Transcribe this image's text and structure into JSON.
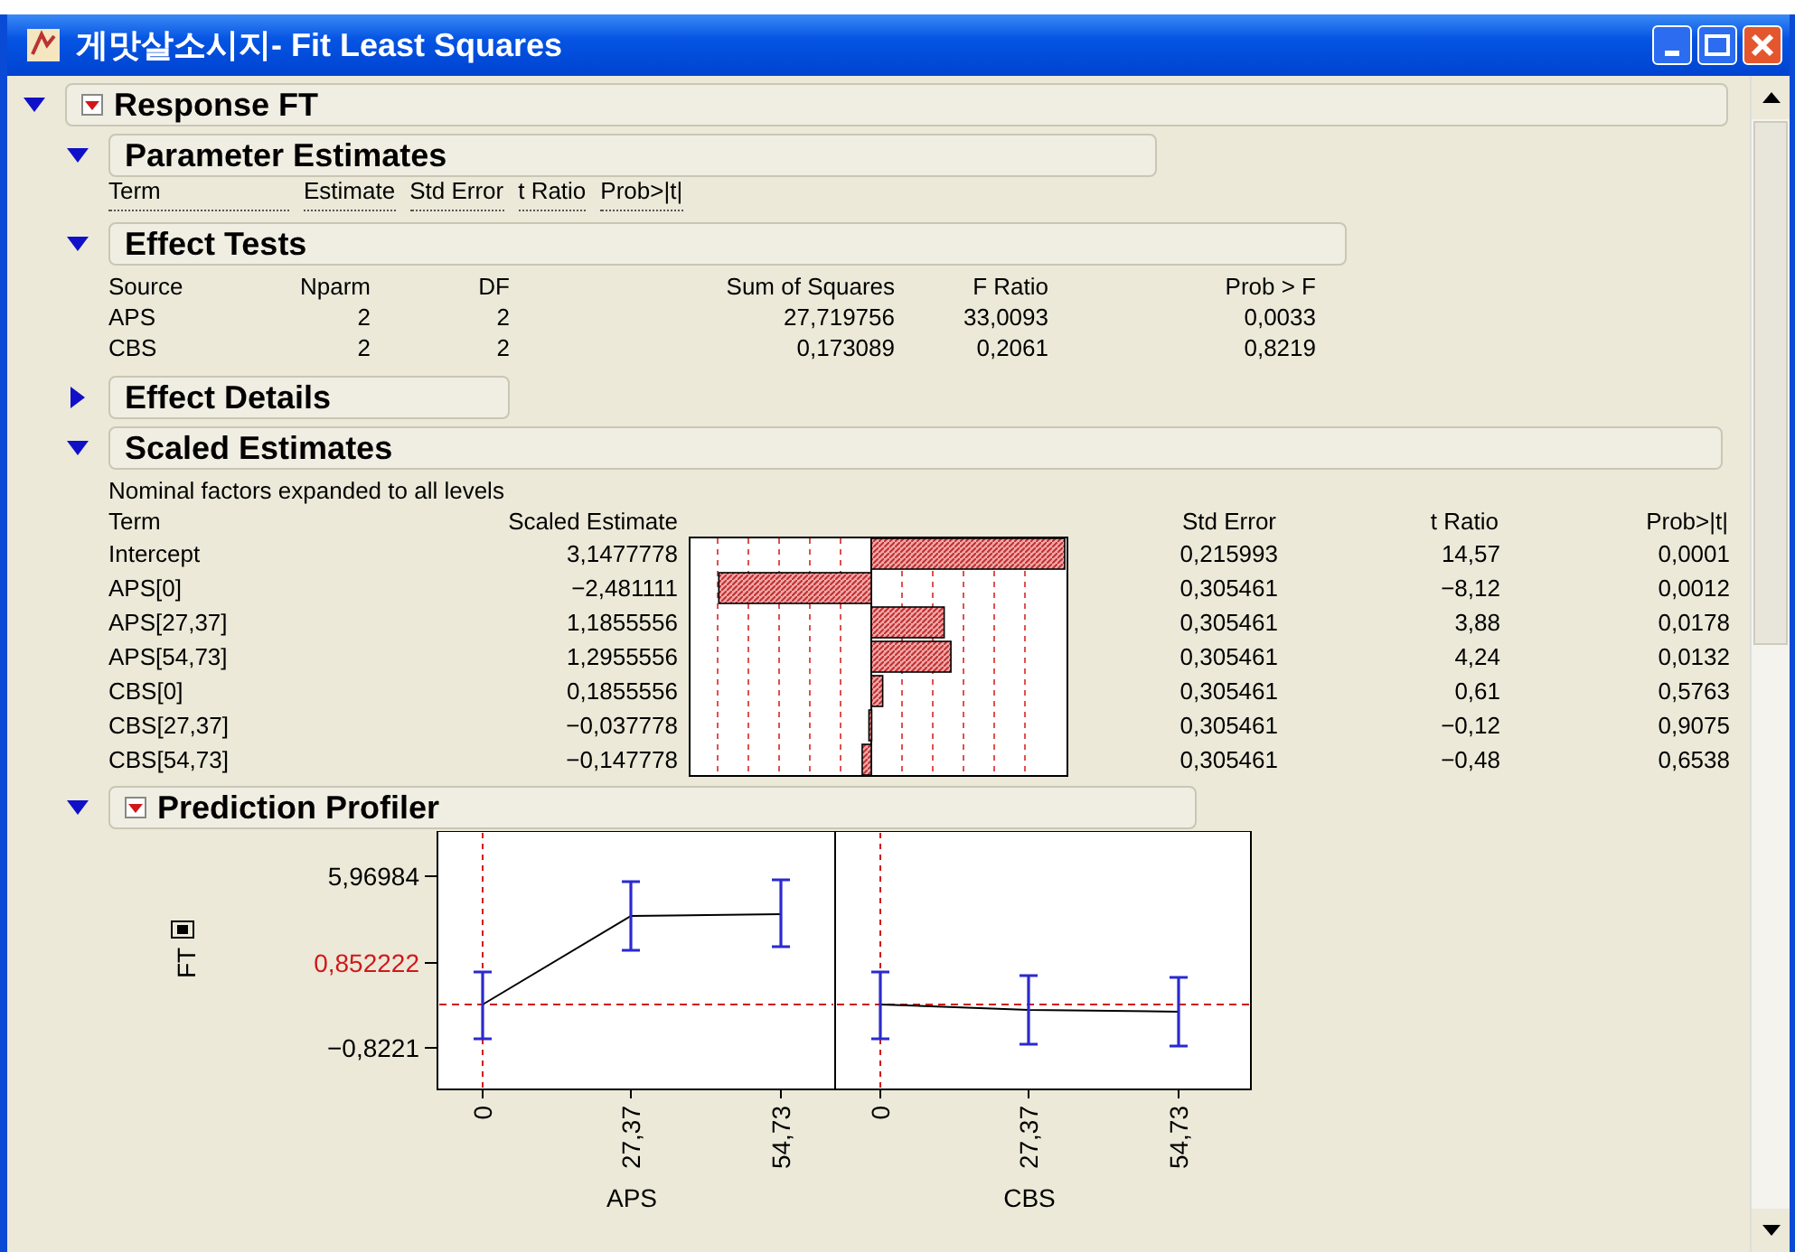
{
  "window": {
    "title": "게맛살소시지- Fit Least Squares"
  },
  "report": {
    "title": "Response FT",
    "expanded": true,
    "menu": true
  },
  "sections": [
    {
      "kind": "columns",
      "title": "Parameter Estimates",
      "expanded": true,
      "columns": [
        "Term",
        "Estimate",
        "Std Error",
        "t Ratio",
        "Prob>|t|"
      ]
    },
    {
      "kind": "table",
      "title": "Effect Tests",
      "expanded": true,
      "columns": [
        "Source",
        "Nparm",
        "DF",
        "Sum of Squares",
        "F Ratio",
        "Prob > F"
      ],
      "rows": [
        [
          "APS",
          "2",
          "2",
          "27,719756",
          "33,0093",
          "0,0033"
        ],
        [
          "CBS",
          "2",
          "2",
          "0,173089",
          "0,2061",
          "0,8219"
        ]
      ]
    },
    {
      "kind": "collapsed",
      "title": "Effect Details",
      "expanded": false
    },
    {
      "kind": "scaled",
      "title": "Scaled Estimates",
      "expanded": true,
      "note": "Nominal factors expanded to all levels",
      "columns": [
        "Term",
        "Scaled Estimate",
        "Std Error",
        "t Ratio",
        "Prob>|t|"
      ],
      "rows": [
        {
          "term": "Intercept",
          "estimate": "3,1477778",
          "std_error": "0,215993",
          "t_ratio": "14,57",
          "prob": "0,0001"
        },
        {
          "term": "APS[0]",
          "estimate": "−2,481111",
          "std_error": "0,305461",
          "t_ratio": "−8,12",
          "prob": "0,0012"
        },
        {
          "term": "APS[27,37]",
          "estimate": "1,1855556",
          "std_error": "0,305461",
          "t_ratio": "3,88",
          "prob": "0,0178"
        },
        {
          "term": "APS[54,73]",
          "estimate": "1,2955556",
          "std_error": "0,305461",
          "t_ratio": "4,24",
          "prob": "0,0132"
        },
        {
          "term": "CBS[0]",
          "estimate": "0,1855556",
          "std_error": "0,305461",
          "t_ratio": "0,61",
          "prob": "0,5763"
        },
        {
          "term": "CBS[27,37]",
          "estimate": "−0,037778",
          "std_error": "0,305461",
          "t_ratio": "−0,12",
          "prob": "0,9075"
        },
        {
          "term": "CBS[54,73]",
          "estimate": "−0,147778",
          "std_error": "0,305461",
          "t_ratio": "−0,48",
          "prob": "0,6538"
        }
      ]
    },
    {
      "kind": "profiler",
      "title": "Prediction Profiler",
      "expanded": true,
      "menu": true,
      "y_label": "FT",
      "y_ticks": [
        {
          "label": "5,96984",
          "current": false
        },
        {
          "label": "0,852222",
          "current": true
        },
        {
          "label": "−0,8221",
          "current": false
        }
      ],
      "factors": [
        {
          "name": "APS",
          "ticks": [
            "0",
            "27,37",
            "54,73"
          ]
        },
        {
          "name": "CBS",
          "ticks": [
            "0",
            "27,37",
            "54,73"
          ]
        }
      ]
    }
  ]
}
